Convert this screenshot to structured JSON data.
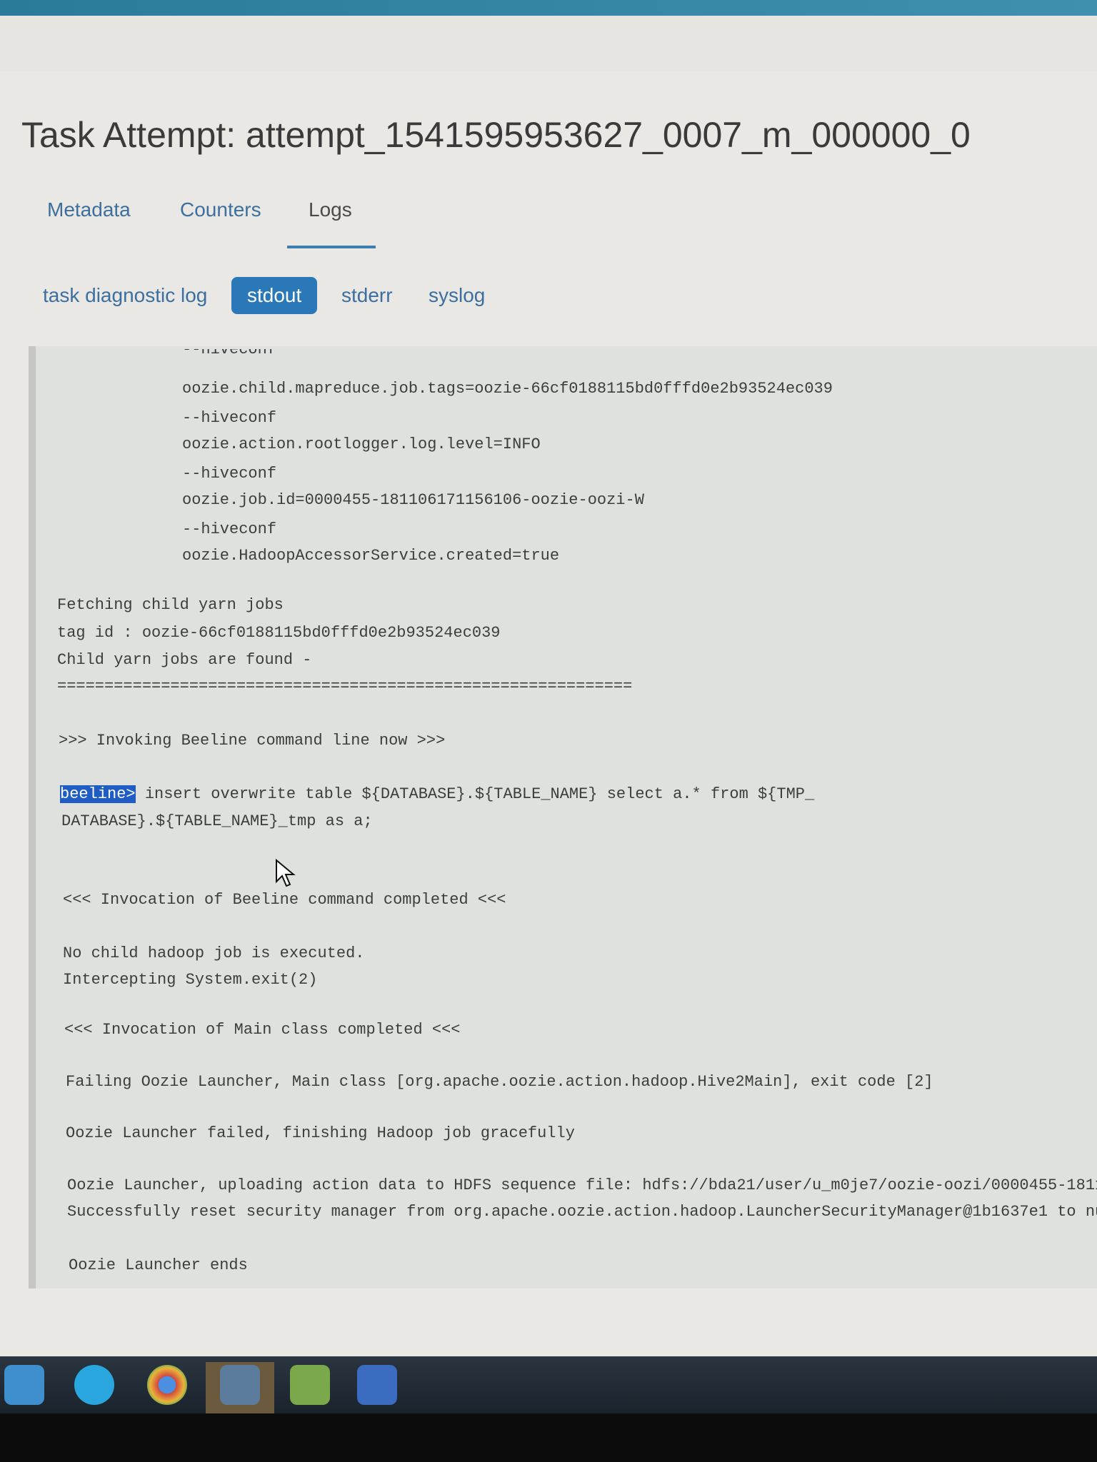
{
  "page": {
    "title": "Task Attempt: attempt_1541595953627_0007_m_000000_0"
  },
  "tabs": [
    {
      "label": "Metadata"
    },
    {
      "label": "Counters"
    },
    {
      "label": "Logs",
      "active": true
    }
  ],
  "log_tabs": [
    {
      "label": "task diagnostic log"
    },
    {
      "label": "stdout",
      "active": true
    },
    {
      "label": "stderr"
    },
    {
      "label": "syslog"
    }
  ],
  "log": {
    "lines": [
      "--hiveconf",
      "oozie.child.mapreduce.job.tags=oozie-66cf0188115bd0fffd0e2b93524ec039",
      "--hiveconf",
      "oozie.action.rootlogger.log.level=INFO",
      "--hiveconf",
      "oozie.job.id=0000455-181106171156106-oozie-oozi-W",
      "--hiveconf",
      "oozie.HadoopAccessorService.created=true",
      "Fetching child yarn jobs",
      "tag id : oozie-66cf0188115bd0fffd0e2b93524ec039",
      "Child yarn jobs are found -",
      "=============================================================",
      ">>> Invoking Beeline command line now >>>",
      "beeline>",
      " insert overwrite table ${DATABASE}.${TABLE_NAME} select a.* from ${TMP_",
      "DATABASE}.${TABLE_NAME}_tmp as a;",
      "<<< Invocation of Beeline command completed <<<",
      "No child hadoop job is executed.",
      "Intercepting System.exit(2)",
      "<<< Invocation of Main class completed <<<",
      "Failing Oozie Launcher, Main class [org.apache.oozie.action.hadoop.Hive2Main], exit code [2]",
      "Oozie Launcher failed, finishing Hadoop job gracefully",
      "Oozie Launcher, uploading action data to HDFS sequence file: hdfs://bda21/user/u_m0je7/oozie-oozi/0000455-1811",
      "Successfully reset security manager from org.apache.oozie.action.hadoop.LauncherSecurityManager@1b1637e1 to nu",
      "Oozie Launcher ends"
    ]
  },
  "taskbar": {
    "icons": [
      "windows-start-icon",
      "skype-icon",
      "chrome-icon",
      "network-app-icon",
      "chart-app-icon",
      "remote-desktop-icon"
    ]
  }
}
